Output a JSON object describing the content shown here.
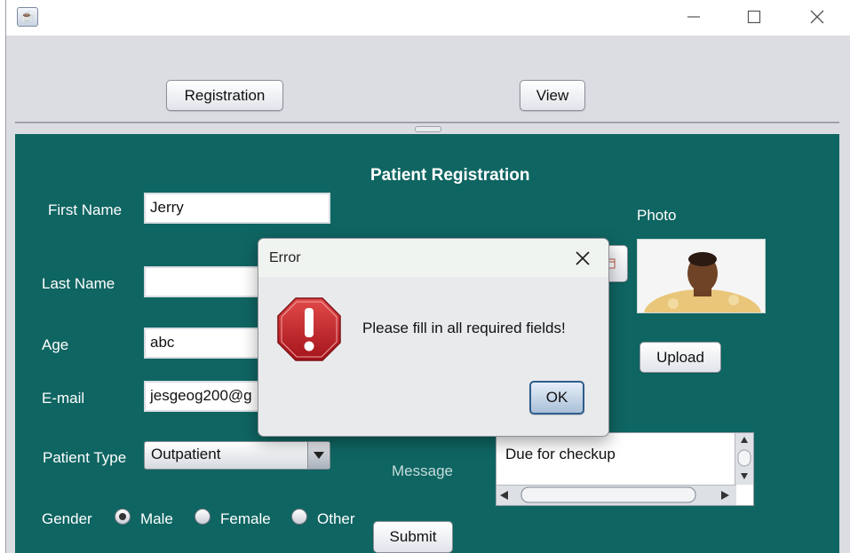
{
  "window": {
    "title": ""
  },
  "top_nav": {
    "registration_label": "Registration",
    "view_label": "View"
  },
  "form": {
    "heading": "Patient Registration",
    "first_name": {
      "label": "First Name",
      "value": "Jerry"
    },
    "last_name": {
      "label": "Last Name",
      "value": ""
    },
    "age": {
      "label": "Age",
      "value": "abc"
    },
    "email": {
      "label": "E-mail",
      "value": "jesgeog200@g"
    },
    "patient_type": {
      "label": "Patient Type",
      "selected": "Outpatient"
    },
    "gender": {
      "label": "Gender",
      "options": [
        "Male",
        "Female",
        "Other"
      ],
      "selected": "Male"
    },
    "photo_label": "Photo",
    "upload_label": "Upload",
    "message": {
      "label": "Message",
      "value": "Due for checkup"
    },
    "submit_label": "Submit"
  },
  "dialog": {
    "title": "Error",
    "message": "Please fill in all required fields!",
    "ok_label": "OK",
    "icon": "error-stop-icon"
  },
  "colors": {
    "panel": "#0f6562",
    "error_red": "#c8262b"
  }
}
